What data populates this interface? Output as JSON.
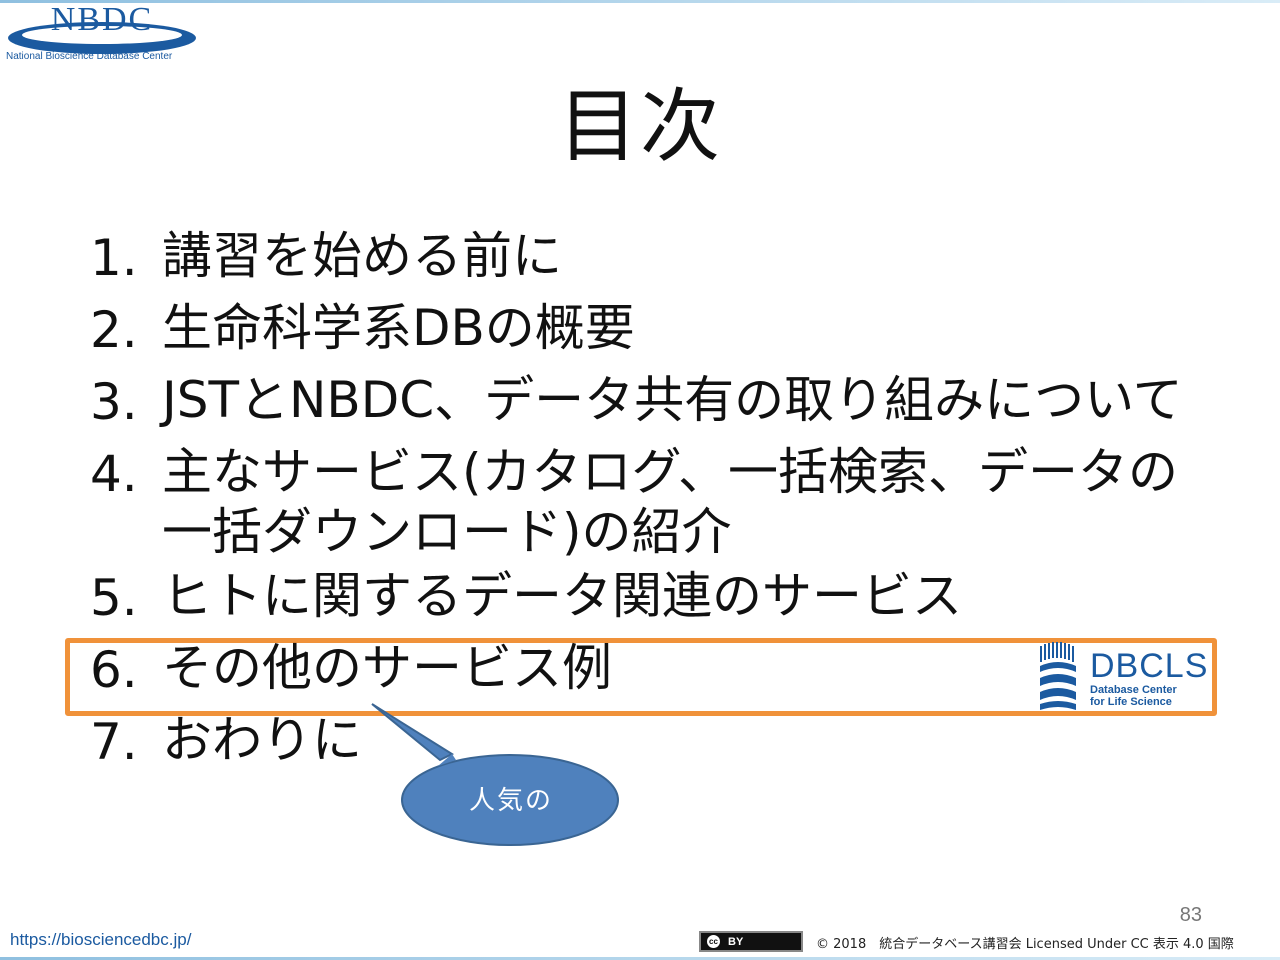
{
  "logo": {
    "wordmark": "NBDC",
    "subtitle": "National Bioscience Database Center"
  },
  "slide": {
    "title": "目次",
    "items": [
      {
        "num": "1.",
        "text": "講習を始める前に"
      },
      {
        "num": "2.",
        "text": "生命科学系DBの概要"
      },
      {
        "num": "3.",
        "text": "JSTとNBDC、データ共有の取り組みについて"
      },
      {
        "num": "4.",
        "text": "主なサービス(カタログ、一括検索、データの一括ダウンロード)の紹介"
      },
      {
        "num": "5.",
        "text": "ヒトに関するデータ関連のサービス"
      },
      {
        "num": "6.",
        "text": "その他のサービス例"
      },
      {
        "num": "7.",
        "text": "おわりに"
      }
    ],
    "highlight_color": "#f0923a"
  },
  "dbcls_logo": {
    "name": "DBCLS",
    "line1": "Database Center",
    "line2": "for Life Science"
  },
  "callout": {
    "text": "人気の",
    "fill": "#4f81bd"
  },
  "footer": {
    "page_number": "83",
    "url": "https://biosciencedbc.jp/",
    "cc_label": "BY",
    "cc_symbol": "cc",
    "copyright": "© 2018　統合データベース講習会 Licensed Under CC 表示 4.0 国際"
  }
}
